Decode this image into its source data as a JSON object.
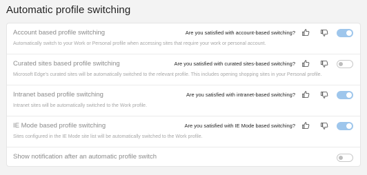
{
  "page": {
    "title": "Automatic profile switching"
  },
  "settings": [
    {
      "title": "Account based profile switching",
      "description": "Automatically switch to your Work or Personal profile when accessing sites that require your work or personal account.",
      "question": "Are you satisfied with account-based switching?",
      "enabled": true
    },
    {
      "title": "Curated sites based profile switching",
      "description": "Microsoft Edge's curated sites will be automatically switched to the relevant profile. This includes opening shopping sites in your Personal profile.",
      "question": "Are you satisfied with curated sites-based switching?",
      "enabled": false
    },
    {
      "title": "Intranet based profile switching",
      "description": "Intranet sites will be automatically switched to the Work profile.",
      "question": "Are you satisfied with intranet-based switching?",
      "enabled": true
    },
    {
      "title": "IE Mode based profile switching",
      "description": "Sites configured in the IE Mode site list will be automatically switched to the Work profile.",
      "question": "Are you satisfied with IE Mode based switching?",
      "enabled": true
    },
    {
      "title": "Show notification after an automatic profile switch",
      "enabled": false
    }
  ],
  "icons": {
    "thumbs_up": "thumbs-up-icon",
    "thumbs_down": "thumbs-down-icon"
  },
  "colors": {
    "toggle_on": "#9ec6ec",
    "toggle_off_border": "#c8c8c8"
  }
}
